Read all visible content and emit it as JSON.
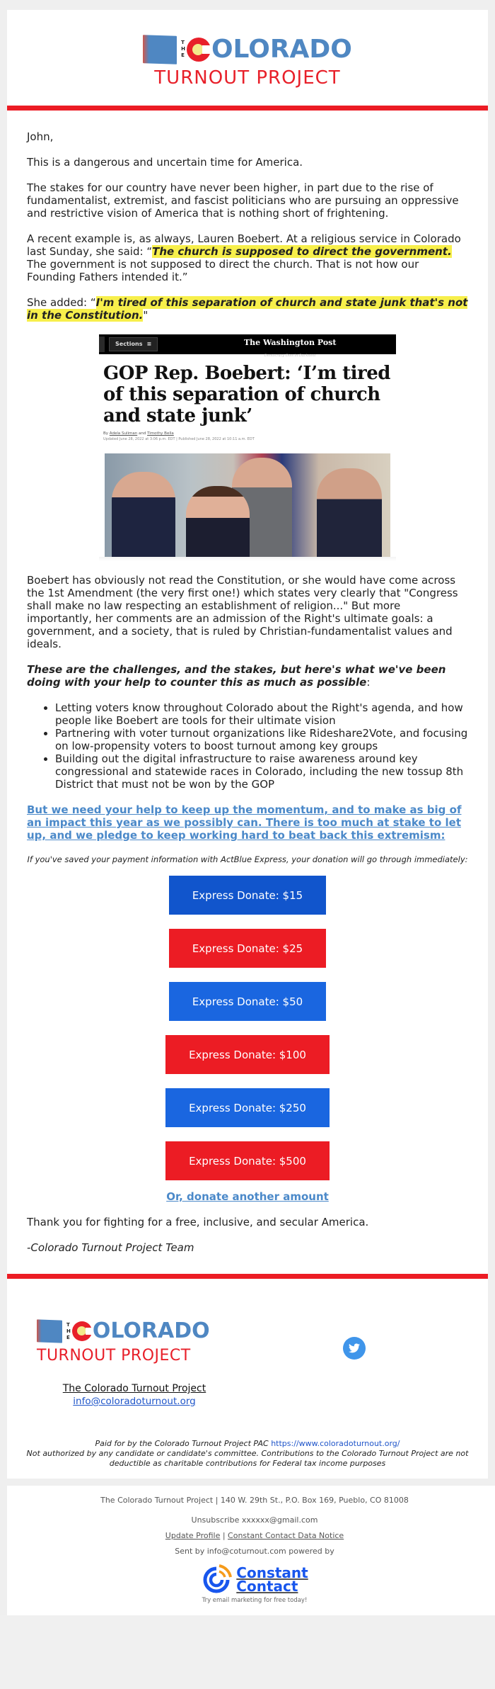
{
  "header": {
    "logo": {
      "the": [
        "T",
        "H",
        "E"
      ],
      "colorado_rest": "OLORADO",
      "turnout": "TURNOUT PROJECT"
    }
  },
  "colors": {
    "brand_red": "#ec1c24",
    "brand_blue": "#4f87c2",
    "button_blue_dark": "#1155cc",
    "button_blue": "#1a66e0",
    "button_red": "#ec1c24",
    "link_blue": "#4b89c9",
    "highlight_yellow": "#f7ef4b",
    "twitter_blue": "#3f95ea"
  },
  "body": {
    "greeting": "John,",
    "p1": "This is a dangerous and uncertain time for America.",
    "p2": "The stakes for our country have never been higher, in part due to the rise of fundamentalist, extremist, and fascist politicians who are pursuing an oppressive and restrictive vision of America that is nothing short of frightening.",
    "p3_intro": "A recent example is, as always, Lauren Boebert. At a religious service in Colorado last Sunday, she said: “",
    "p3_highlight": "The church is supposed to direct the government.",
    "p3_rest": " The government is not supposed to direct the church. That is not how our Founding Fathers intended it.”",
    "p4_intro": "She added: “",
    "p4_highlight": "I'm tired of this separation of church and state junk that's not in the Constitution.",
    "p4_close": "\"",
    "article": {
      "sections_label": "Sections",
      "masthead": "The Washington Post",
      "tagline": "Democracy Dies in Darkness",
      "headline": "GOP Rep. Boebert: ‘I’m tired of this separation of church and state junk’",
      "byline_prefix": "By ",
      "author1": "Adela Suliman",
      "byline_and": " and ",
      "author2": "Timothy Bella",
      "dates": "Updated June 28, 2022 at 3:06 p.m. EDT  |  Published June 28, 2022 at 10:11 a.m. EDT"
    },
    "p5": "Boebert has obviously not read the Constitution, or she would have come across the 1st Amendment (the very first one!) which states very clearly that \"Congress shall make no law respecting an establishment of religion...\" But more importantly, her comments are an admission of the Right's ultimate goals: a government, and a society, that is ruled by Christian-fundamentalist values and ideals.",
    "p6_bold": "These are the challenges, and the stakes, but here's what we've been doing with your help to counter this as much as possible",
    "p6_colon": ":",
    "bullets": [
      "Letting voters know throughout Colorado about the Right's agenda, and how people like Boebert are tools for their ultimate vision",
      "Partnering with voter turnout organizations like Rideshare2Vote, and focusing on low-propensity voters to boost turnout among key groups",
      "Building out the digital infrastructure to raise awareness around key congressional and statewide races in Colorado, including the new tossup 8th District that must not be won by the GOP"
    ],
    "cta_link": "But we need your help to keep up the momentum, and to make as big of an impact this year as we possibly can. There is too much at stake to let up, and we pledge to keep working hard to beat back this extremism:",
    "express_note": "If you've saved your payment information with ActBlue Express, your donation will go through immediately:",
    "donate_buttons": [
      {
        "label": "Express Donate: $15",
        "color": "#1155cc"
      },
      {
        "label": "Express Donate: $25",
        "color": "#ec1c24"
      },
      {
        "label": "Express Donate: $50",
        "color": "#1a66e0"
      },
      {
        "label": "Express Donate: $100",
        "color": "#ec1c24"
      },
      {
        "label": "Express Donate: $250",
        "color": "#1a66e0"
      },
      {
        "label": "Express Donate: $500",
        "color": "#ec1c24"
      }
    ],
    "other_amount": "Or, donate another amount",
    "thanks": "Thank you for fighting for a free, inclusive, and secular America.",
    "signature": "-Colorado Turnout Project Team"
  },
  "footer": {
    "org_name": "The Colorado Turnout Project",
    "org_email": "info@coloradoturnout.org",
    "social": "twitter-icon",
    "paid_for": "Paid for by the Colorado Turnout Project PAC ",
    "paid_url": "https://www.coloradoturnout.org/",
    "disclaimer": "Not authorized by any candidate or candidate's committee. Contributions to the Colorado Turnout Project are not deductible as charitable contributions for Federal tax income purposes"
  },
  "cc_footer": {
    "address": "The Colorado Turnout Project | 140 W. 29th St., P.O. Box 169, Pueblo, CO 81008",
    "unsubscribe": "Unsubscribe xxxxxx@gmail.com",
    "update_profile": "Update Profile",
    "separator": " | ",
    "data_notice": "Constant Contact Data Notice",
    "sent_by": "Sent by info@coturnout.com powered by",
    "cc_word1": "Constant",
    "cc_word2": "Contact",
    "cc_tagline": "Try email marketing for free today!"
  }
}
